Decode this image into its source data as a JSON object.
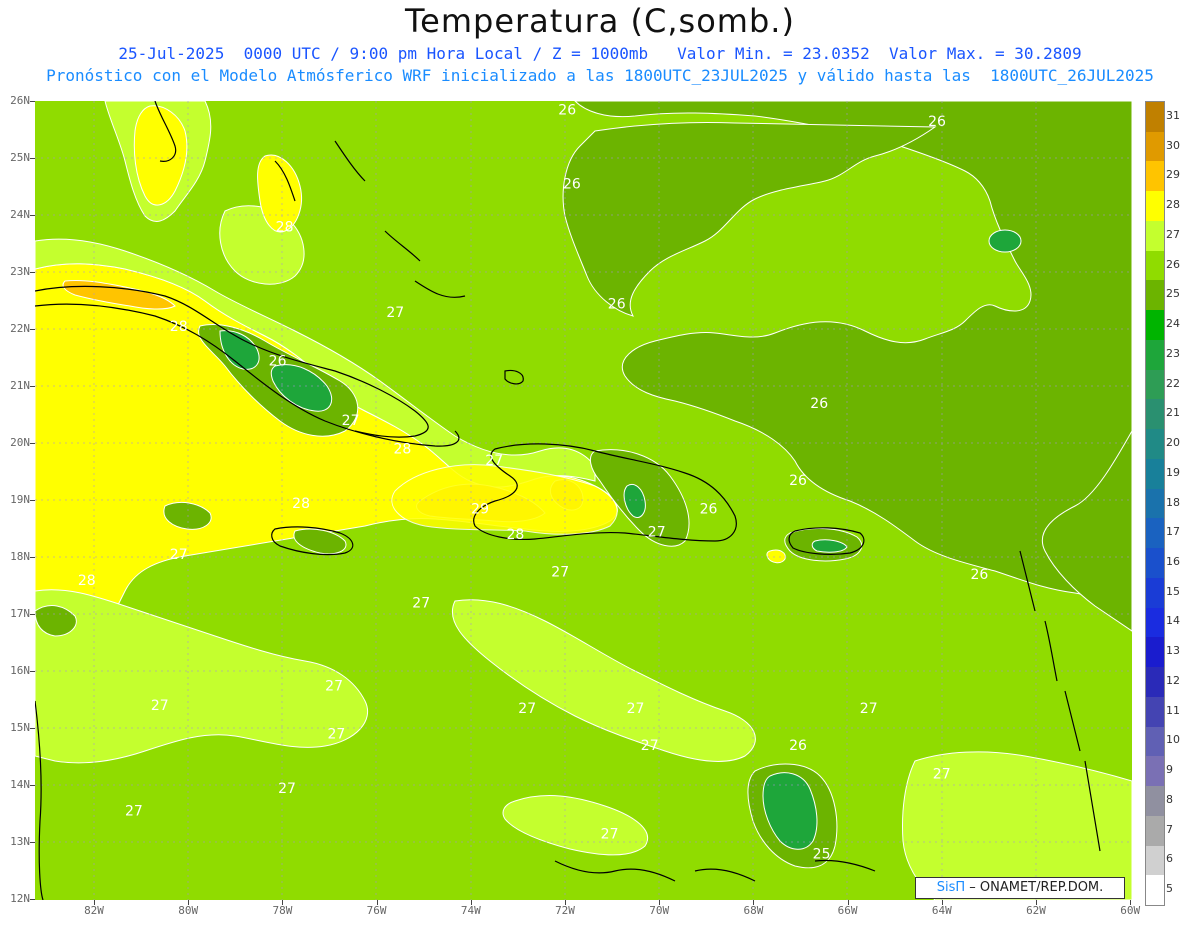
{
  "header": {
    "title": "Temperatura (C,somb.)",
    "line1": "25-Jul-2025  0000 UTC / 9:00 pm Hora Local / Z = 1000mb   Valor Min. = 23.0352  Valor Max. = 30.2809",
    "line2": "Pronóstico con el Modelo Atmósferico WRF inicializado a las 1800UTC_23JUL2025 y válido hasta las  1800UTC_26JUL2025"
  },
  "axes": {
    "lat_labels": [
      "26N",
      "25N",
      "24N",
      "23N",
      "22N",
      "21N",
      "20N",
      "19N",
      "18N",
      "17N",
      "16N",
      "15N",
      "14N",
      "13N",
      "12N"
    ],
    "lon_labels": [
      "82W",
      "80W",
      "78W",
      "76W",
      "74W",
      "72W",
      "70W",
      "68W",
      "66W",
      "64W",
      "62W",
      "60W"
    ]
  },
  "colorbar": {
    "levels": [
      "31",
      "30",
      "29",
      "28",
      "27",
      "26",
      "25",
      "24",
      "23",
      "22",
      "21",
      "20",
      "19",
      "18",
      "17",
      "16",
      "15",
      "14",
      "13",
      "12",
      "11",
      "10",
      "9",
      "8",
      "7",
      "6",
      "5"
    ],
    "colors": [
      "#c08000",
      "#e09a00",
      "#ffc400",
      "#ffff00",
      "#c4ff2e",
      "#90dc00",
      "#6cb400",
      "#00b400",
      "#1ea63a",
      "#2e9d55",
      "#2a9070",
      "#208a86",
      "#18809a",
      "#1a72ac",
      "#1a62c0",
      "#1a50cc",
      "#1a3cd6",
      "#1a2ce0",
      "#1a1cce",
      "#2a2ab8",
      "#4444b2",
      "#6060b4",
      "#7a70b4",
      "#9090a0",
      "#aaaaaa",
      "#d0d0d0",
      "#ffffff"
    ]
  },
  "contour_labels": [
    {
      "text": "26",
      "lat": 25.85,
      "lon": -71.95
    },
    {
      "text": "26",
      "lat": 25.65,
      "lon": -64.1
    },
    {
      "text": "26",
      "lat": 24.55,
      "lon": -71.85
    },
    {
      "text": "28",
      "lat": 23.8,
      "lon": -77.95
    },
    {
      "text": "27",
      "lat": 22.3,
      "lon": -75.6
    },
    {
      "text": "26",
      "lat": 22.45,
      "lon": -70.9
    },
    {
      "text": "28",
      "lat": 22.05,
      "lon": -80.2
    },
    {
      "text": "26",
      "lat": 21.45,
      "lon": -78.1
    },
    {
      "text": "27",
      "lat": 20.4,
      "lon": -76.55
    },
    {
      "text": "26",
      "lat": 20.7,
      "lon": -66.6
    },
    {
      "text": "28",
      "lat": 19.9,
      "lon": -75.45
    },
    {
      "text": "27",
      "lat": 19.7,
      "lon": -73.5
    },
    {
      "text": "26",
      "lat": 19.35,
      "lon": -67.05
    },
    {
      "text": "28",
      "lat": 18.95,
      "lon": -77.6
    },
    {
      "text": "29",
      "lat": 18.85,
      "lon": -73.8
    },
    {
      "text": "26",
      "lat": 18.85,
      "lon": -68.95
    },
    {
      "text": "27",
      "lat": 18.45,
      "lon": -70.05
    },
    {
      "text": "28",
      "lat": 18.4,
      "lon": -73.05
    },
    {
      "text": "27",
      "lat": 18.05,
      "lon": -80.2
    },
    {
      "text": "27",
      "lat": 17.75,
      "lon": -72.1
    },
    {
      "text": "26",
      "lat": 17.7,
      "lon": -63.2
    },
    {
      "text": "28",
      "lat": 17.6,
      "lon": -82.15
    },
    {
      "text": "27",
      "lat": 17.2,
      "lon": -75.05
    },
    {
      "text": "27",
      "lat": 15.75,
      "lon": -76.9
    },
    {
      "text": "27",
      "lat": 15.4,
      "lon": -80.6
    },
    {
      "text": "27",
      "lat": 15.35,
      "lon": -72.8
    },
    {
      "text": "27",
      "lat": 15.35,
      "lon": -70.5
    },
    {
      "text": "27",
      "lat": 15.35,
      "lon": -65.55
    },
    {
      "text": "27",
      "lat": 14.9,
      "lon": -76.85
    },
    {
      "text": "27",
      "lat": 14.7,
      "lon": -70.2
    },
    {
      "text": "26",
      "lat": 14.7,
      "lon": -67.05
    },
    {
      "text": "27",
      "lat": 14.2,
      "lon": -64.0
    },
    {
      "text": "27",
      "lat": 13.95,
      "lon": -77.9
    },
    {
      "text": "27",
      "lat": 13.55,
      "lon": -81.15
    },
    {
      "text": "27",
      "lat": 13.15,
      "lon": -71.05
    },
    {
      "text": "25",
      "lat": 12.8,
      "lon": -66.55
    }
  ],
  "credit": {
    "logo": "SisΠ",
    "text": "– ONAMET/REP.DOM."
  }
}
